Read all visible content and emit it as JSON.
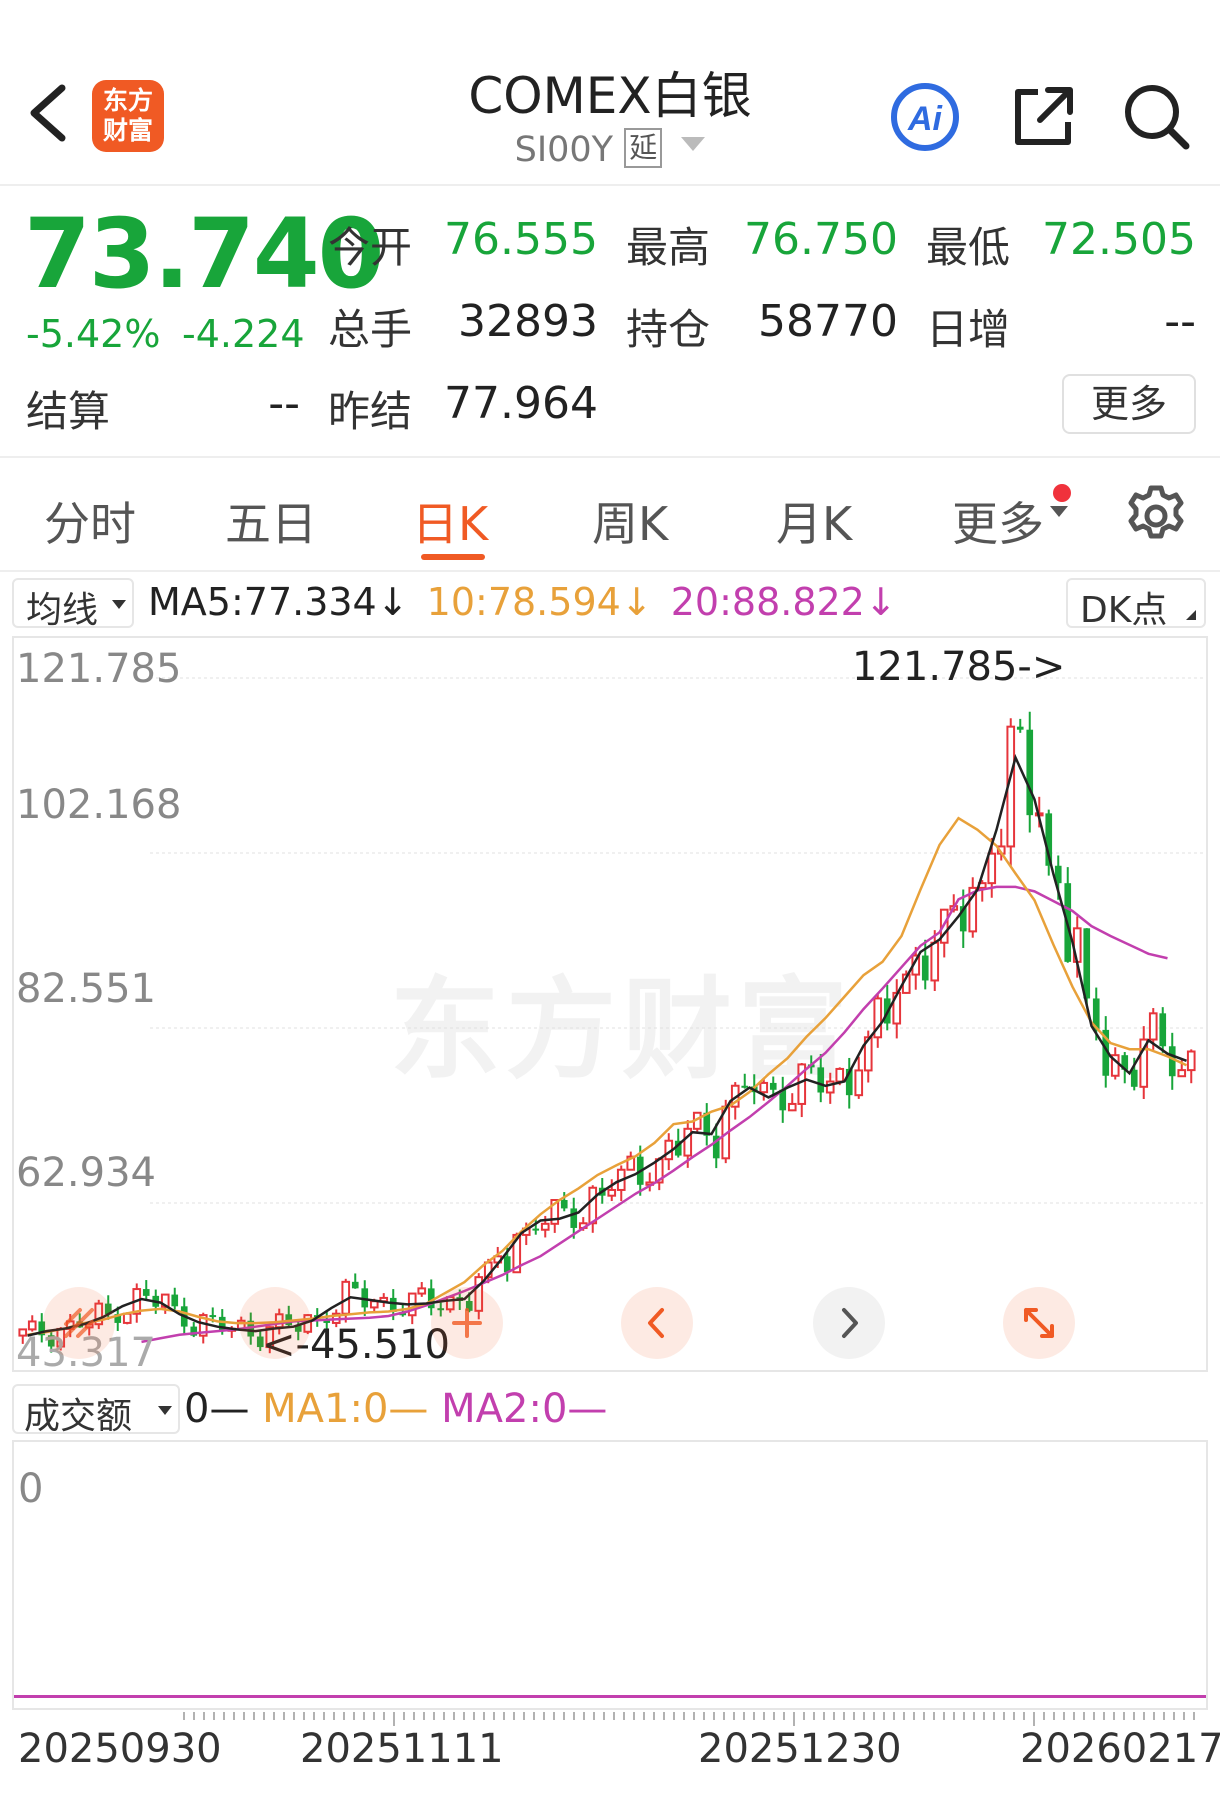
{
  "header": {
    "title": "COMEX白银",
    "code": "SI00Y",
    "delay_badge": "延",
    "logo_line1": "东方",
    "logo_line2": "财富",
    "ai_label": "Ai"
  },
  "quote": {
    "price": "73.740",
    "change_pct": "-5.42%",
    "change": "-4.224",
    "settlement_label": "结算",
    "settlement_value": "--",
    "open_label": "今开",
    "open_value": "76.555",
    "high_label": "最高",
    "high_value": "76.750",
    "low_label": "最低",
    "low_value": "72.505",
    "volume_label": "总手",
    "volume_value": "32893",
    "oi_label": "持仓",
    "oi_value": "58770",
    "daily_inc_label": "日增",
    "daily_inc_value": "--",
    "prev_settle_label": "昨结",
    "prev_settle_value": "77.964",
    "more_label": "更多"
  },
  "tabs": [
    {
      "label": "分时"
    },
    {
      "label": "五日"
    },
    {
      "label": "日K",
      "active": true
    },
    {
      "label": "周K"
    },
    {
      "label": "月K"
    },
    {
      "label": "更多"
    }
  ],
  "ma_bar": {
    "selector": "均线",
    "ma5": "MA5:77.334↓",
    "ma10": "10:78.594↓",
    "ma20": "20:88.822↓",
    "dk_label": "DK点",
    "colors": {
      "ma5": "#222222",
      "ma10": "#e8a13a",
      "ma20": "#c23fae"
    }
  },
  "watermark": "东方财富",
  "colors": {
    "up": "#e6353b",
    "down": "#18a53a",
    "accent": "#f05a24"
  },
  "chart_data": {
    "type": "candlestick",
    "y_ticks": [
      "121.785",
      "102.168",
      "82.551",
      "62.934",
      "43.317"
    ],
    "ylim": [
      43.317,
      121.785
    ],
    "max_marker": "121.785->",
    "min_marker": "<-45.510",
    "x_ticks": [
      "20250930",
      "20251111",
      "20251230",
      "20260217"
    ],
    "ma5": [
      46.5,
      47,
      47.3,
      47.8,
      48.6,
      49.8,
      50.6,
      50.2,
      48.9,
      48.0,
      47.5,
      47.2,
      47.0,
      47.3,
      47.5,
      48.2,
      49.6,
      50.8,
      50.5,
      50.2,
      50.0,
      50.1,
      50.4,
      50.6,
      52.6,
      55.2,
      58.0,
      59.4,
      59.6,
      60.3,
      62.3,
      63.7,
      64.6,
      65.9,
      67.4,
      69.3,
      69.1,
      72.8,
      74.3,
      73.2,
      74.3,
      75.2,
      74.5,
      75.0,
      79.0,
      81.7,
      85.7,
      89.5,
      90.9,
      93.5,
      96.5,
      103.2,
      111.3,
      106.6,
      98.2,
      90.6,
      81.2,
      77.8,
      75.9,
      79.6,
      78.1,
      77.3
    ],
    "ma10": [
      46.6,
      46.9,
      47.3,
      47.9,
      48.3,
      48.9,
      49.3,
      49.5,
      49.2,
      48.6,
      48.1,
      47.9,
      47.9,
      48.0,
      48.2,
      48.4,
      48.7,
      48.9,
      49.1,
      49.2,
      49.5,
      50.1,
      51.3,
      52.5,
      54.4,
      56.0,
      58.2,
      60.1,
      61.7,
      63.0,
      64.5,
      65.6,
      66.6,
      68.1,
      70.2,
      70.5,
      71.6,
      72.3,
      73.8,
      75.8,
      77.6,
      80.0,
      82.1,
      84.5,
      86.9,
      88.4,
      91.3,
      96.5,
      101.5,
      104.5,
      103.2,
      101.4,
      98.3,
      95.3,
      90.3,
      85.6,
      81.6,
      79.3,
      78.6,
      78.6,
      77.8,
      76.8
    ],
    "ma20": [
      45.8,
      46.2,
      46.6,
      46.8,
      47.0,
      47.2,
      47.5,
      47.8,
      48.1,
      48.2,
      48.3,
      48.4,
      48.5,
      48.7,
      49.2,
      49.9,
      50.7,
      51.5,
      52.4,
      53.3,
      54.4,
      55.4,
      56.8,
      58.2,
      59.6,
      61.0,
      62.4,
      63.6,
      65.0,
      66.5,
      67.9,
      69.5,
      71.0,
      72.7,
      74.5,
      76.4,
      78.2,
      80.5,
      83.1,
      85.4,
      87.8,
      90.2,
      91.7,
      95.4,
      96.4,
      96.8,
      96.8,
      96.3,
      95.2,
      94.1,
      92.4,
      91.3,
      90.3,
      89.3,
      88.8
    ]
  }
}
